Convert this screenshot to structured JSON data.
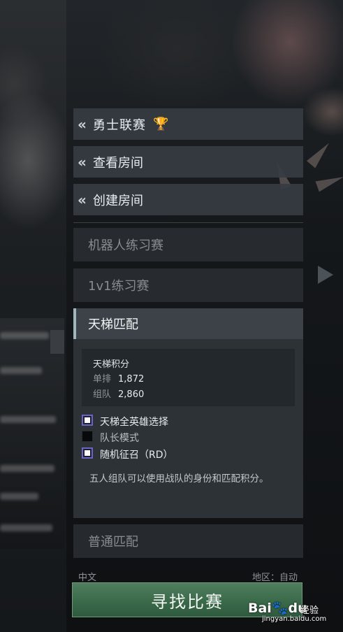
{
  "menu": {
    "league_label": "勇士联赛",
    "view_rooms_label": "查看房间",
    "create_room_label": "创建房间",
    "chevron": "«",
    "trophy_icon": "trophy-icon"
  },
  "options": {
    "bot_practice": "机器人练习赛",
    "one_v_one": "1v1练习赛"
  },
  "ranked": {
    "title": "天梯匹配",
    "score_title": "天梯积分",
    "solo_label": "单排",
    "solo_value": "1,872",
    "party_label": "组队",
    "party_value": "2,860",
    "checkboxes": [
      {
        "label": "天梯全英雄选择",
        "checked": true
      },
      {
        "label": "队长模式",
        "checked": false
      },
      {
        "label": "随机征召（RD）",
        "checked": true
      }
    ],
    "description": "五人组队可以使用战队的身份和匹配积分。"
  },
  "normal_match": "普通匹配",
  "footer": {
    "language": "中文",
    "region": "地区：自动"
  },
  "find_match": "寻找比赛",
  "watermark": {
    "logo_a": "Bai",
    "logo_b": "du",
    "text": "经验",
    "url": "jingyan.baidu.com"
  },
  "colors": {
    "find_button": "#3f6f4e",
    "ranked_accent": "#9fb6bd",
    "checkbox_border": "#6c63c9"
  }
}
